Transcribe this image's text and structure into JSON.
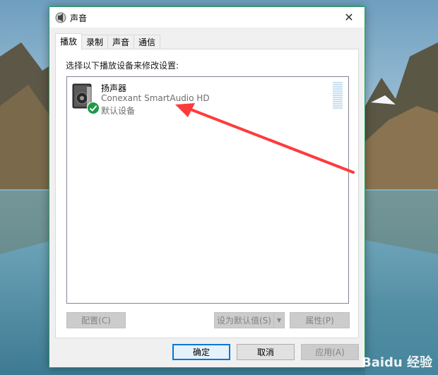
{
  "window": {
    "title": "声音",
    "close_glyph": "✕"
  },
  "tabs": [
    {
      "label": "播放",
      "active": true
    },
    {
      "label": "录制",
      "active": false
    },
    {
      "label": "声音",
      "active": false
    },
    {
      "label": "通信",
      "active": false
    }
  ],
  "panel": {
    "instruction": "选择以下播放设备来修改设置:"
  },
  "device": {
    "name": "扬声器",
    "driver": "Conexant SmartAudio HD",
    "status": "默认设备",
    "icon": "speaker-icon",
    "badge_icon": "checkmark-icon",
    "badge_color": "#1e9b45"
  },
  "buttons": {
    "configure": "配置(C)",
    "set_default": "设为默认值(S)",
    "properties": "属性(P)",
    "ok": "确定",
    "cancel": "取消",
    "apply": "应用(A)"
  },
  "watermark": "Baidu 经验",
  "colors": {
    "accent": "#0078d7",
    "border_active": "#1aa258",
    "annotation_arrow": "#ff3b3b"
  }
}
